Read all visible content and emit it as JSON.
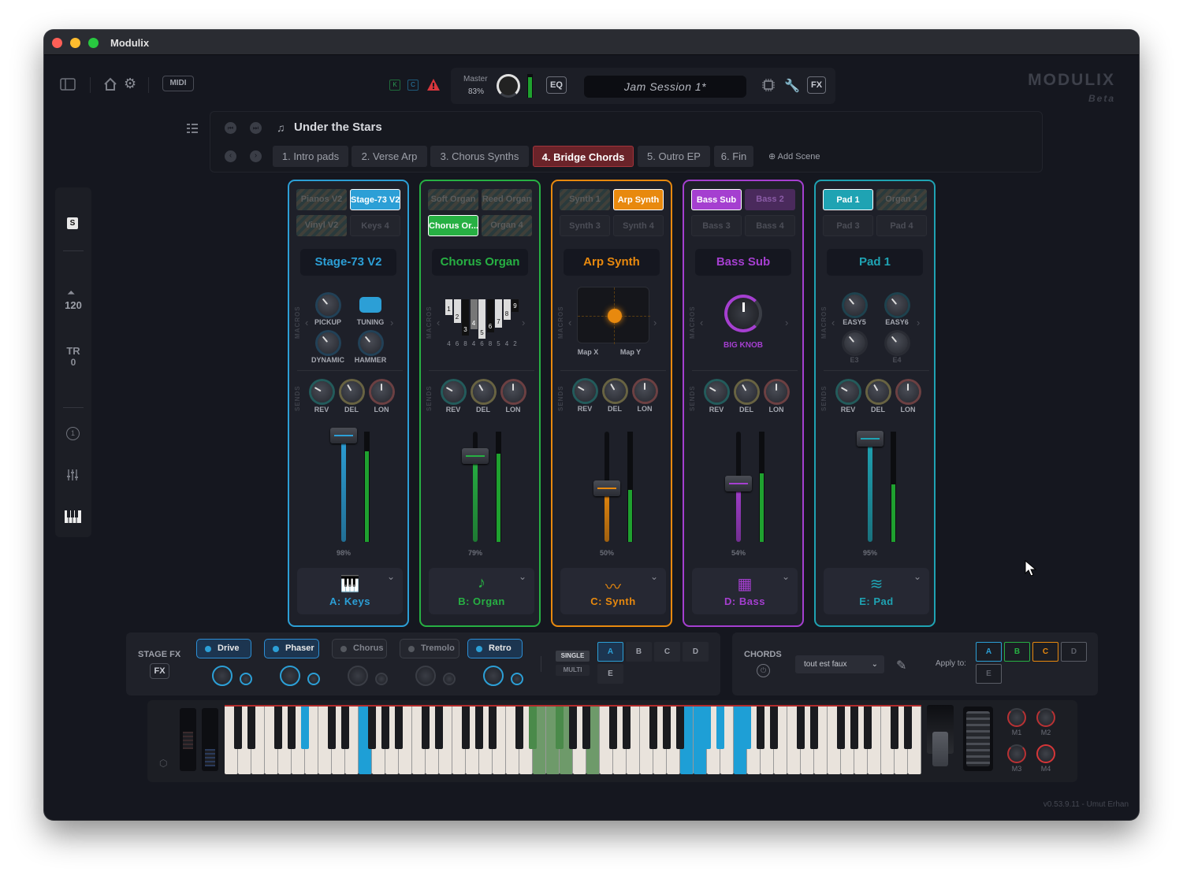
{
  "window": {
    "title": "Modulix"
  },
  "toolbar": {
    "midi_label": "MIDI",
    "k_label": "K",
    "c_label": "C",
    "master_label": "Master",
    "master_value": "83%",
    "eq_label": "EQ",
    "preset_name": "Jam Session 1*",
    "fx_label": "FX",
    "brand": "MODULIX",
    "brand_sub": "Beta"
  },
  "song": {
    "title": "Under the Stars",
    "add_scene": "Add Scene",
    "scenes": [
      "1. Intro pads",
      "2. Verse Arp",
      "3. Chorus Synths",
      "4. Bridge Chords",
      "5. Outro EP",
      "6. Fin"
    ],
    "active_scene": "4. Bridge Chords"
  },
  "sidebar": {
    "s_label": "S",
    "tempo": "120",
    "tr_label": "TR",
    "tr_value": "0"
  },
  "labels": {
    "macros": "MACROS",
    "sends": "SENDS",
    "rev": "REV",
    "del": "DEL",
    "lon": "LON"
  },
  "strips": [
    {
      "color": "#2c9fd6",
      "slots": [
        "Pianos V2",
        "Stage-73 V2",
        "Vinyl V2",
        "Keys 4"
      ],
      "active_slot": 1,
      "title": "Stage-73 V2",
      "macros": [
        "PICKUP",
        "TUNING",
        "DYNAMIC",
        "HAMMER"
      ],
      "level": "98%",
      "level_frac": 0.98,
      "meter": 0.82,
      "instrument": "A: Keys",
      "icon": "piano-icon"
    },
    {
      "color": "#27b043",
      "slots": [
        "Soft Organ",
        "Reed Organ",
        "Chorus Or...",
        "Organ 4"
      ],
      "active_slot": 2,
      "title": "Chorus Organ",
      "drawbars": [
        "1",
        "2",
        "3",
        "4",
        "5",
        "6",
        "7",
        "8",
        "9"
      ],
      "drawbar_nums": [
        "4",
        "6",
        "8",
        "4",
        "6",
        "8",
        "5",
        "4",
        "2"
      ],
      "level": "79%",
      "level_frac": 0.79,
      "meter": 0.8,
      "instrument": "B: Organ",
      "icon": "music-note-icon"
    },
    {
      "color": "#e8890e",
      "slots": [
        "Synth 1",
        "Arp Synth",
        "Synth 3",
        "Synth 4"
      ],
      "active_slot": 1,
      "title": "Arp Synth",
      "xy": [
        "Map X",
        "Map Y"
      ],
      "level": "50%",
      "level_frac": 0.5,
      "meter": 0.47,
      "instrument": "C: Synth",
      "icon": "waveform-icon"
    },
    {
      "color": "#a53fd0",
      "slots": [
        "Bass Sub",
        "Bass 2",
        "Bass 3",
        "Bass 4"
      ],
      "active_slot": 0,
      "title": "Bass Sub",
      "bigknob": "BIG KNOB",
      "level": "54%",
      "level_frac": 0.54,
      "meter": 0.62,
      "instrument": "D: Bass",
      "icon": "grid-icon"
    },
    {
      "color": "#1fa3b3",
      "slots": [
        "Pad 1",
        "Organ 1",
        "Pad 3",
        "Pad 4"
      ],
      "active_slot": 0,
      "title": "Pad 1",
      "macros": [
        "EASY5",
        "EASY6",
        "E3",
        "E4"
      ],
      "level": "95%",
      "level_frac": 0.95,
      "meter": 0.52,
      "instrument": "E: Pad",
      "icon": "pad-icon"
    }
  ],
  "stagefx": {
    "label": "STAGE FX",
    "fx": "FX",
    "buttons": [
      "Drive",
      "Phaser",
      "Chorus",
      "Tremolo",
      "Retro"
    ],
    "active": [
      "Drive",
      "Phaser",
      "Retro"
    ],
    "single": "SINGLE",
    "multi": "MULTI",
    "targets": [
      "A",
      "B",
      "C",
      "D",
      "E"
    ]
  },
  "chords": {
    "label": "CHORDS",
    "preset": "tout est faux",
    "apply": "Apply to:",
    "targets": [
      "A",
      "B",
      "C",
      "D",
      "E"
    ]
  },
  "macros_kb": [
    "M1",
    "M2",
    "M3",
    "M4"
  ],
  "version": "v0.53.9.11 - Umut Erhan",
  "colors": {
    "bg": "#15171f",
    "panel": "#1e2029",
    "accent_red": "#a3343c"
  }
}
